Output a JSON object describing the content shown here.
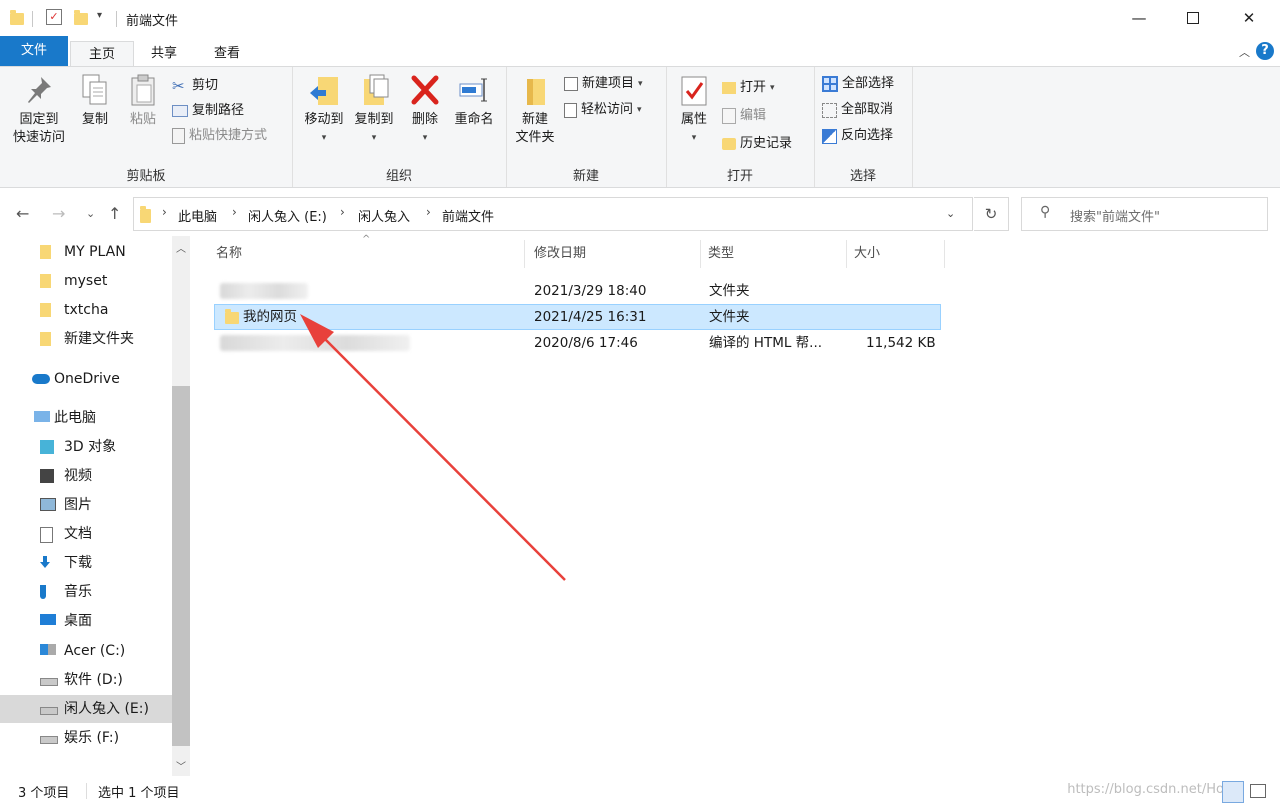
{
  "window": {
    "title": "前端文件"
  },
  "ribbon_tabs": {
    "file": "文件",
    "home": "主页",
    "share": "共享",
    "view": "查看"
  },
  "ribbon": {
    "clipboard": {
      "label": "剪贴板",
      "pin_line1": "固定到",
      "pin_line2": "快速访问",
      "copy": "复制",
      "paste": "粘贴",
      "cut": "剪切",
      "copy_path": "复制路径",
      "paste_shortcut": "粘贴快捷方式"
    },
    "organize": {
      "label": "组织",
      "move_to": "移动到",
      "copy_to": "复制到",
      "delete": "删除",
      "rename": "重命名"
    },
    "new": {
      "label": "新建",
      "new_folder_line1": "新建",
      "new_folder_line2": "文件夹",
      "new_item": "新建项目",
      "easy_access": "轻松访问"
    },
    "open": {
      "label": "打开",
      "properties": "属性",
      "open": "打开",
      "edit": "编辑",
      "history": "历史记录"
    },
    "select": {
      "label": "选择",
      "select_all": "全部选择",
      "select_none": "全部取消",
      "invert": "反向选择"
    }
  },
  "address": {
    "crumbs": [
      "此电脑",
      "闲人兔入 (E:)",
      "闲人兔入",
      "前端文件"
    ],
    "search_placeholder": "搜索\"前端文件\""
  },
  "nav_pane": {
    "items": [
      {
        "label": "MY PLAN",
        "icon": "folder-icon"
      },
      {
        "label": "myset",
        "icon": "folder-icon"
      },
      {
        "label": "txtcha",
        "icon": "folder-icon"
      },
      {
        "label": "新建文件夹",
        "icon": "folder-icon"
      },
      {
        "label": "OneDrive",
        "icon": "cloud-icon"
      },
      {
        "label": "此电脑",
        "icon": "computer-icon"
      },
      {
        "label": "3D 对象",
        "icon": "cube-icon"
      },
      {
        "label": "视频",
        "icon": "video-icon"
      },
      {
        "label": "图片",
        "icon": "picture-icon"
      },
      {
        "label": "文档",
        "icon": "document-icon"
      },
      {
        "label": "下载",
        "icon": "download-icon"
      },
      {
        "label": "音乐",
        "icon": "music-icon"
      },
      {
        "label": "桌面",
        "icon": "desktop-icon"
      },
      {
        "label": "Acer (C:)",
        "icon": "windows-drive-icon"
      },
      {
        "label": "软件 (D:)",
        "icon": "drive-icon"
      },
      {
        "label": "闲人兔入 (E:)",
        "icon": "drive-icon"
      },
      {
        "label": "娱乐 (F:)",
        "icon": "drive-icon"
      }
    ]
  },
  "file_list": {
    "columns": {
      "name": "名称",
      "modified": "修改日期",
      "type": "类型",
      "size": "大小"
    },
    "rows": [
      {
        "name": "",
        "modified": "2021/3/29 18:40",
        "type": "文件夹",
        "size": ""
      },
      {
        "name": "我的网页",
        "modified": "2021/4/25 16:31",
        "type": "文件夹",
        "size": ""
      },
      {
        "name": "",
        "modified": "2020/8/6 17:46",
        "type": "编译的 HTML 帮...",
        "size": "11,542 KB"
      }
    ]
  },
  "status": {
    "count": "3 个项目",
    "selected": "选中 1 个项目",
    "watermark": "https://blog.csdn.net/Ho"
  },
  "colors": {
    "accent": "#1979ca",
    "selection": "#cce8ff",
    "annotation_arrow": "#e8413b"
  }
}
